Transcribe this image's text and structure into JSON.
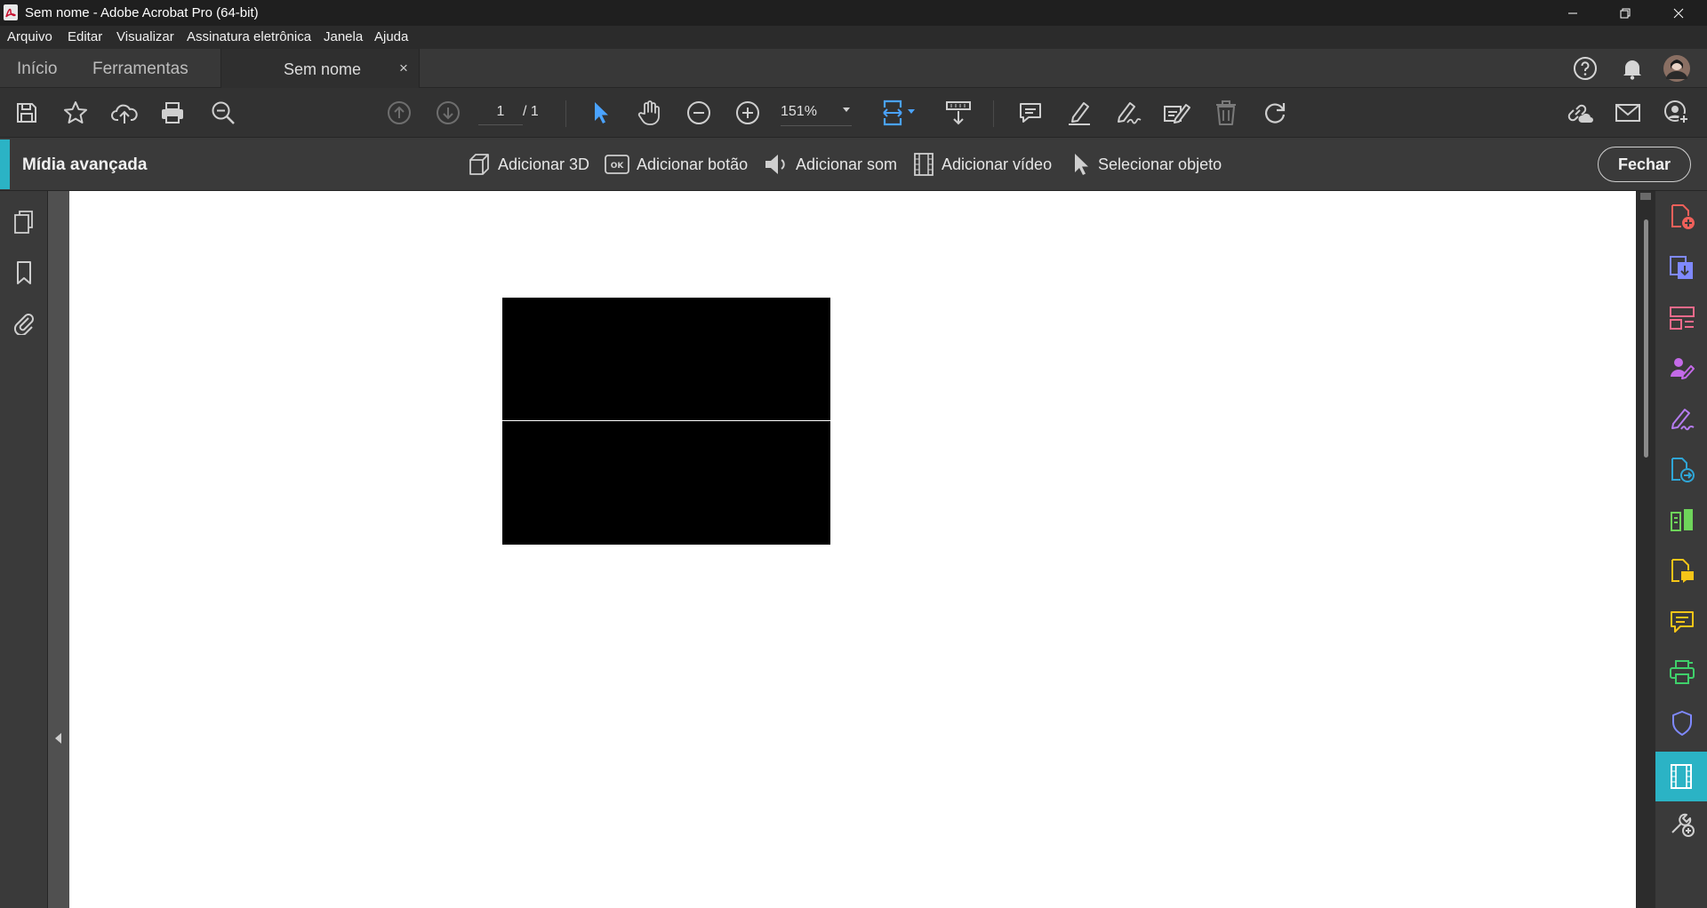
{
  "window": {
    "title": "Sem nome - Adobe Acrobat Pro (64-bit)"
  },
  "menu": {
    "items": [
      "Arquivo",
      "Editar",
      "Visualizar",
      "Assinatura eletrônica",
      "Janela",
      "Ajuda"
    ]
  },
  "tabs": {
    "home": "Início",
    "tools": "Ferramentas",
    "document": "Sem nome",
    "close_symbol": "×"
  },
  "toolbar": {
    "page_current": "1",
    "page_total": "/ 1",
    "zoom": "151%"
  },
  "media_toolbar": {
    "title": "Mídia avançada",
    "add_3d": "Adicionar 3D",
    "add_button": "Adicionar botão",
    "add_sound": "Adicionar som",
    "add_video": "Adicionar vídeo",
    "select_object": "Selecionar objeto",
    "close": "Fechar",
    "ok_badge": "OK"
  },
  "colors": {
    "accent": "#2bb3c5",
    "select_tool": "#4aa3ff"
  }
}
